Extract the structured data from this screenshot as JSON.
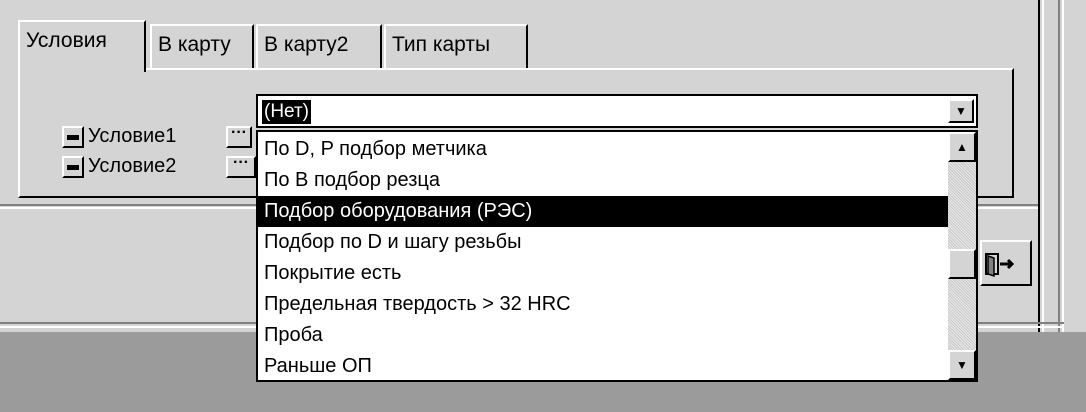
{
  "tabs": [
    {
      "label": "Условия",
      "active": true
    },
    {
      "label": "В карту",
      "active": false
    },
    {
      "label": "В карту2",
      "active": false
    },
    {
      "label": "Тип карты",
      "active": false
    }
  ],
  "conditions": [
    {
      "label": "Условие1",
      "remove_icon": "minus-icon",
      "more_label": "···"
    },
    {
      "label": "Условие2",
      "remove_icon": "minus-icon",
      "more_label": "···"
    }
  ],
  "combo": {
    "value": "(Нет)",
    "arrow_icon": "chevron-down-icon"
  },
  "dropdown": {
    "items": [
      "По D, P подбор метчика",
      "По В подбор резца",
      "Подбор оборудования (РЭС)",
      "Подбор по D и шагу резьбы",
      "Покрытие есть",
      "Предельная твердость > 32 HRC",
      "Проба",
      "Раньше ОП"
    ],
    "selected_index": 2,
    "scroll_position": 0.55
  },
  "exit_button": {
    "icon": "exit-door-icon"
  },
  "colors": {
    "face": "#d4d4d4",
    "selection": "#000000",
    "list_bg": "#ffffff",
    "lower_area": "#9b9b9b"
  }
}
